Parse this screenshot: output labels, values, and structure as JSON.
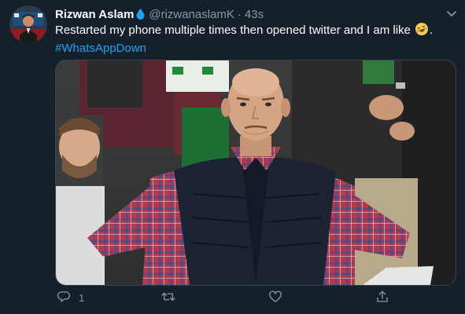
{
  "tweet": {
    "display_name": "Rizwan Aslam",
    "handle": "@rizwanaslamK",
    "separator": "·",
    "time": "43s",
    "text": "Restarted my phone multiple times then opened twitter and I am like ",
    "text_end": ".",
    "hashtag": "#WhatsAppDown"
  },
  "actions": {
    "reply_count": "1",
    "retweet_count": "",
    "like_count": "",
    "share_count": ""
  },
  "colors": {
    "background": "#15202b",
    "secondary_text": "#8899a6",
    "accent": "#1da1f2"
  },
  "icons": [
    "drop-icon",
    "chevron-down-icon",
    "laughing-emoji-icon",
    "reply-icon",
    "retweet-icon",
    "like-icon",
    "share-icon"
  ]
}
